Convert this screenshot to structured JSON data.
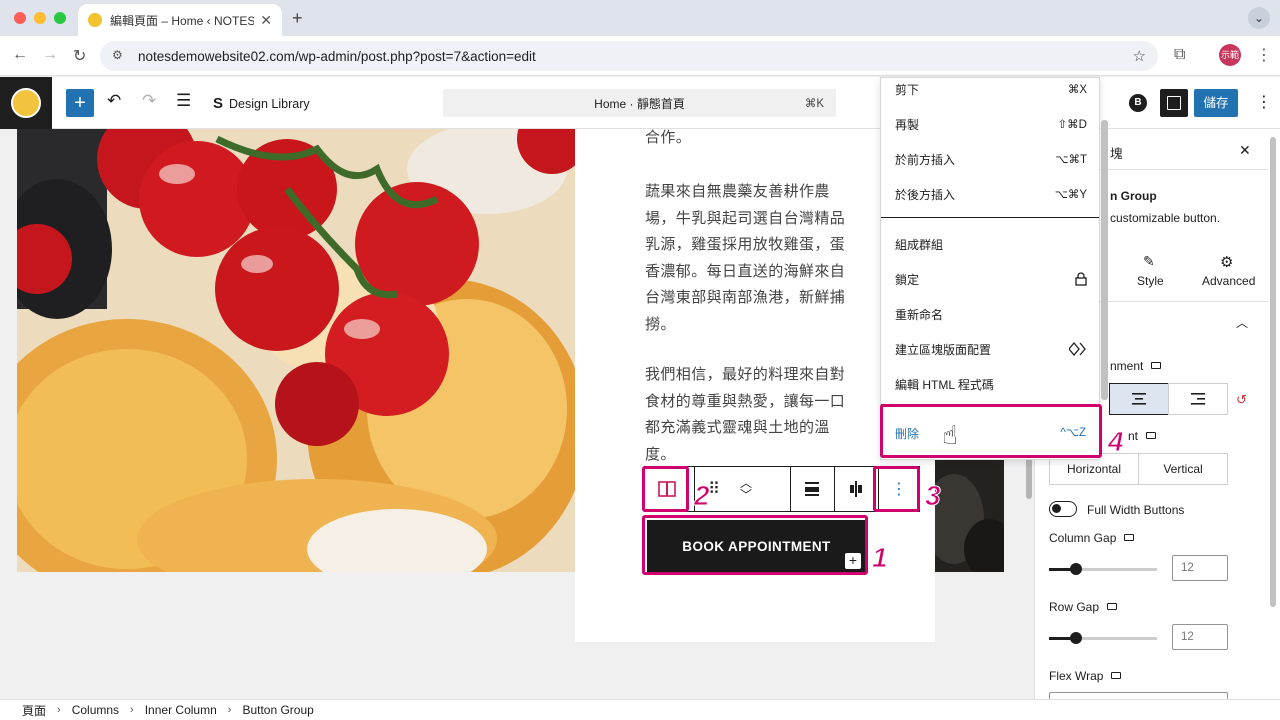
{
  "browser": {
    "tab_title": "編輯頁面 – Home ‹ NOTES Ital",
    "tab_close": "✕",
    "new_tab": "+",
    "url": "notesdemowebsite02.com/wp-admin/post.php?post=7&action=edit",
    "profile_label": "示範"
  },
  "toolbar": {
    "design_library": "Design Library",
    "document_title": "Home · 靜態首頁",
    "command_shortcut": "⌘K",
    "save_label": "儲存",
    "b_icon_label": "B"
  },
  "content": {
    "para0": "合作。",
    "para1": "蔬果來自無農藥友善耕作農場，牛乳與起司選自台灣精品乳源，雞蛋採用放牧雞蛋，蛋香濃郁。每日直送的海鮮來自台灣東部與南部漁港，新鮮捕撈。",
    "para2": "我們相信，最好的料理來自對食材的尊重與熱愛，讓每一口都充滿義式靈魂與土地的溫度。",
    "button_label": "BOOK APPOINTMENT"
  },
  "annotations": [
    "1",
    "2",
    "3",
    "4"
  ],
  "menu": {
    "items": [
      {
        "label": "剪下",
        "shortcut": "⌘X"
      },
      {
        "label": "再製",
        "shortcut": "⇧⌘D"
      },
      {
        "label": "於前方插入",
        "shortcut": "⌥⌘T"
      },
      {
        "label": "於後方插入",
        "shortcut": "⌥⌘Y"
      },
      {
        "label": "組成群組",
        "shortcut": ""
      },
      {
        "label": "鎖定",
        "shortcut": ""
      },
      {
        "label": "重新命名",
        "shortcut": ""
      },
      {
        "label": "建立區塊版面配置",
        "shortcut": ""
      },
      {
        "label": "編輯 HTML 程式碼",
        "shortcut": ""
      }
    ],
    "delete": {
      "label": "刪除",
      "shortcut": "^⌥Z"
    }
  },
  "sidebar": {
    "tab_partial": "塊",
    "close": "✕",
    "block_name_partial": "n Group",
    "block_desc_partial": "customizable button.",
    "style_tab": "Style",
    "advanced_tab": "Advanced",
    "alignment_partial": "nment",
    "orientation_partial": "nt",
    "orientation_options": [
      "Horizontal",
      "Vertical"
    ],
    "full_width": "Full Width Buttons",
    "column_gap": {
      "label": "Column Gap",
      "value": "12",
      "level": 0.25
    },
    "row_gap": {
      "label": "Row Gap",
      "value": "12",
      "level": 0.25
    },
    "flex_wrap": "Flex Wrap"
  },
  "breadcrumb": [
    "頁面",
    "Columns",
    "Inner Column",
    "Button Group"
  ],
  "colors": {
    "highlight": "#d0006f",
    "wp_blue": "#2271b1"
  }
}
